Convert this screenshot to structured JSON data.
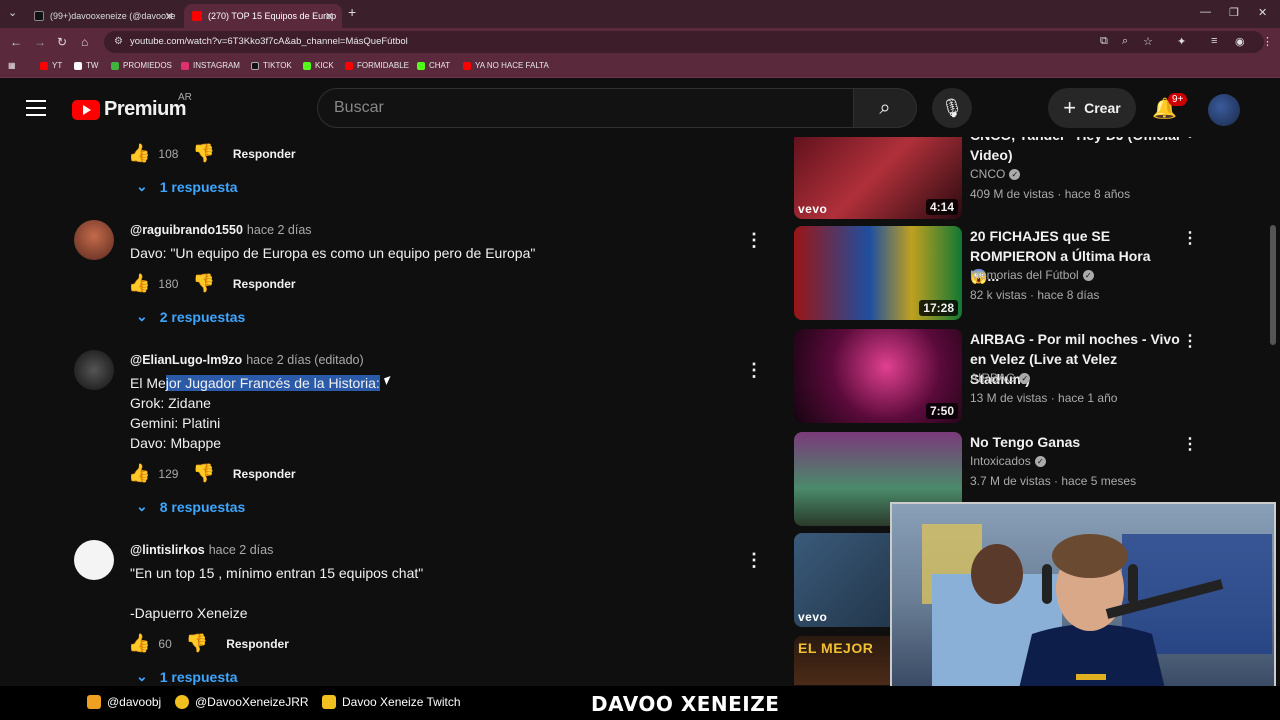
{
  "browser": {
    "tabs": [
      {
        "label": "(99+)davooxeneize (@davooxe",
        "active": false
      },
      {
        "label": "(270) TOP 15 Equipos de Europ",
        "active": true
      }
    ],
    "new_tab": "+",
    "url": "youtube.com/watch?v=6T3Kko3f7cA&ab_channel=MásQueFútbol",
    "bookmarks": [
      "YT",
      "TW",
      "PROMIEDOS",
      "INSTAGRAM",
      "TIKTOK",
      "KICK",
      "FORMIDABLE",
      "CHAT",
      "YA NO HACE FALTA"
    ]
  },
  "yt": {
    "logo": "Premium",
    "country": "AR",
    "search_placeholder": "Buscar",
    "create_label": "Crear",
    "notif_badge": "9+"
  },
  "comments": [
    {
      "likes": "108",
      "reply": "Responder",
      "replies": "1 respuesta"
    },
    {
      "author": "@raguibrando1550",
      "when": "hace 2 días",
      "lines": [
        "Davo: \"Un equipo de Europa es como un equipo pero de Europa\""
      ],
      "likes": "180",
      "reply": "Responder",
      "replies": "2 respuestas"
    },
    {
      "author": "@ElianLugo-lm9zo",
      "when": "hace 2 días (editado)",
      "line1_a": "El Me",
      "line1_b": "jor Jugador Francés de la Historia:",
      "lines": [
        "Grok: Zidane",
        "Gemini: Platini",
        "Davo: Mbappe"
      ],
      "likes": "129",
      "reply": "Responder",
      "replies": "8 respuestas"
    },
    {
      "author": "@lintislirkos",
      "when": "hace 2 días",
      "lines": [
        "\"En un top 15 , mínimo entran 15 equipos chat\"",
        "",
        "-Dapuerro Xeneize"
      ],
      "likes": "60",
      "reply": "Responder",
      "replies": "1 respuesta"
    }
  ],
  "related": [
    {
      "title": "CNCO, Yandel - Hey DJ (Official Video)",
      "channel": "CNCO",
      "meta": "409 M de vistas · hace 8 años",
      "duration": "4:14",
      "badge": "vevo"
    },
    {
      "title": "20 FICHAJES que SE ROMPIERON a Última Hora 😱...",
      "channel": "Memorias del Fútbol",
      "meta": "82 k vistas · hace 8 días",
      "duration": "17:28",
      "badge": ""
    },
    {
      "title": "AIRBAG - Por mil noches - Vivo en Velez (Live at Velez Stadium)",
      "channel": "AIRBAG",
      "meta": "13 M de vistas · hace 1 año",
      "duration": "7:50",
      "badge": ""
    },
    {
      "title": "No Tengo Ganas",
      "channel": "Intoxicados",
      "meta": "3.7 M de vistas · hace 5 meses",
      "duration": "",
      "badge": ""
    },
    {
      "title": "",
      "channel": "",
      "meta": "",
      "duration": "",
      "badge": "vevo"
    },
    {
      "title": "",
      "channel": "",
      "meta": "",
      "duration": "",
      "badge": "EL MEJOR"
    }
  ],
  "stream_bar": {
    "instagram": "@davoobj",
    "twitter": "@DavooXeneizeJRR",
    "twitch": "Davoo Xeneize Twitch",
    "title": "DAVOO XENEIZE"
  },
  "colors": {
    "youtube_red": "#ff0000",
    "link_blue": "#3ea6ff",
    "browser_frame": "#5a2a3c"
  }
}
